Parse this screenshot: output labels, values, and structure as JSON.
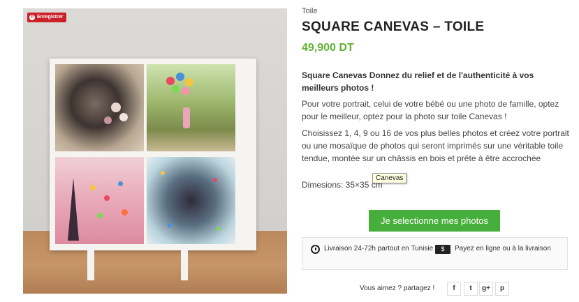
{
  "image": {
    "save_label": "Enregistrer",
    "pin_glyph": "P"
  },
  "product": {
    "category": "Toile",
    "title": "SQUARE CANEVAS – TOILE",
    "price": "49,900 DT",
    "description_heading": "Square Canevas Donnez du relief et de l'authenticité à vos meilleurs photos !",
    "paragraph1": "Pour votre portrait, celui de votre bébé ou une photo de famille, optez pour le meilleur, optez pour la photo sur toile Canevas !",
    "paragraph2": "Choisissez 1, 4, 9 ou 16 de vos plus belles photos et créez votre portrait ou une mosaïque de photos qui seront imprimés sur une véritable toile tendue, montée sur un châssis en bois et prête à être accrochée",
    "dimensions": "Dimesions: 35×35 cm",
    "tooltip": "Canevas",
    "cta_label": "Je selectionne mes photos"
  },
  "delivery": {
    "shipping": "Livraison 24-72h partout en Tunisie",
    "payment": "Payez en ligne ou à la livraison",
    "payment_icon_glyph": "$"
  },
  "share": {
    "label": "Vous aimez ? partagez !",
    "facebook": "f",
    "twitter": "t",
    "googleplus": "g+",
    "pinterest": "p"
  },
  "colors": {
    "price": "#5fb233",
    "cta": "#46ae3a",
    "pinterest": "#cb2027"
  }
}
